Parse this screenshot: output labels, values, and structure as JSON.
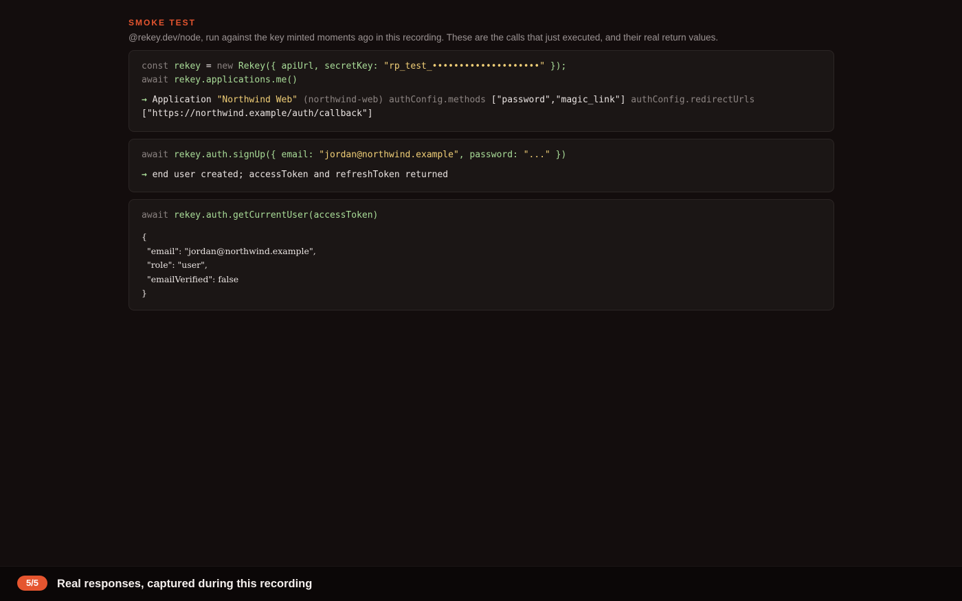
{
  "header": {
    "eyebrow": "SMOKE TEST",
    "subtitle": "@rekey.dev/node, run against the key minted moments ago in this recording. These are the calls that just executed, and their real return values."
  },
  "cards": [
    {
      "line1": {
        "const": "const",
        "var": "rekey",
        "eq": " = ",
        "new": "new",
        "ctor": "Rekey({ apiUrl, secretKey: ",
        "secret": "\"rp_test_••••••••••••••••••••\"",
        "close": " });"
      },
      "line2": {
        "await": "await",
        "call": "rekey.applications.me()"
      },
      "result": {
        "arrow": "→",
        "label": "Application",
        "name": "\"Northwind Web\"",
        "slug": "(northwind-web)",
        "methods_key": "authConfig.methods",
        "methods_val": "[\"password\",\"magic_link\"]",
        "redirect_key": "authConfig.redirectUrls",
        "redirect_val": "[\"https://northwind.example/auth/callback\"]"
      }
    },
    {
      "line1": {
        "await": "await",
        "call": "rekey.auth.signUp({ email: ",
        "email": "\"jordan@northwind.example\"",
        "sep": ", password: ",
        "password": "\"...\"",
        "close": " })"
      },
      "result": {
        "arrow": "→",
        "text": "end user created; accessToken and refreshToken returned"
      }
    },
    {
      "line1": {
        "await": "await",
        "call": "rekey.auth.getCurrentUser(accessToken)"
      },
      "json": {
        "open": "{",
        "email_line": "  \"email\": \"jordan@northwind.example\",",
        "role_line": "  \"role\": \"user\",",
        "verified_line": "  \"emailVerified\": false",
        "close": "}"
      }
    }
  ],
  "footer": {
    "step": "5/5",
    "caption": "Real responses, captured during this recording"
  },
  "colors": {
    "accent": "#e5552f",
    "function": "#a9dc98",
    "string": "#f1cf77",
    "background": "#130d0d"
  }
}
